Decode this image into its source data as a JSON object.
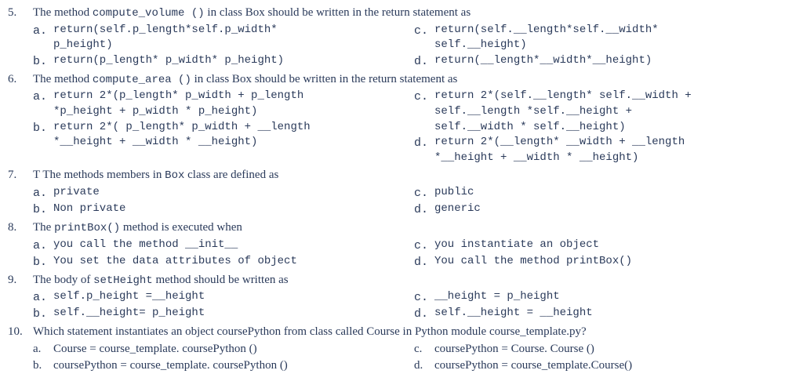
{
  "questions": [
    {
      "num": "5.",
      "stem_pre": "The method ",
      "stem_code": "compute_volume ()",
      "stem_post": "  in class Box should be written in the return statement as",
      "options": {
        "a": {
          "letter": "a.",
          "lines": [
            "return(self.p_length*self.p_width*",
            "p_height)"
          ]
        },
        "b": {
          "letter": "b.",
          "lines": [
            "return(p_length* p_width* p_height)"
          ]
        },
        "c": {
          "letter": "c.",
          "lines": [
            "return(self.__length*self.__width*",
            "self.__height)"
          ]
        },
        "d": {
          "letter": "d.",
          "lines": [
            "return(__length*__width*__height)"
          ]
        }
      }
    },
    {
      "num": "6.",
      "stem_pre": "The method ",
      "stem_code": "compute_area ()",
      "stem_post": "  in class Box should be written in the return statement as",
      "options": {
        "a": {
          "letter": "a.",
          "lines": [
            "return 2*(p_length* p_width + p_length",
            "*p_height + p_width * p_height)"
          ]
        },
        "b": {
          "letter": "b.",
          "lines": [
            "return 2*( p_length* p_width + __length",
            "*__height + __width * __height)"
          ]
        },
        "c": {
          "letter": "c.",
          "lines": [
            "return 2*(self.__length* self.__width +",
            "self.__length *self.__height +",
            "self.__width * self.__height)"
          ]
        },
        "d": {
          "letter": "d.",
          "lines": [
            "return 2*(__length* __width + __length",
            "*__height + __width * __height)"
          ]
        }
      }
    },
    {
      "num": "7.",
      "stem_pre": "T   The methods members in ",
      "stem_code": "Box",
      "stem_post": " class  are defined as",
      "options": {
        "a": {
          "letter": "a.",
          "lines": [
            "private"
          ]
        },
        "b": {
          "letter": "b.",
          "lines": [
            "Non private"
          ]
        },
        "c": {
          "letter": "c.",
          "lines": [
            "public"
          ]
        },
        "d": {
          "letter": "d.",
          "lines": [
            "generic"
          ]
        }
      }
    },
    {
      "num": "8.",
      "stem_pre": "The ",
      "stem_code": "printBox()",
      "stem_post": " method is executed when",
      "options": {
        "a": {
          "letter": "a.",
          "lines": [
            "you call the method __init__"
          ]
        },
        "b": {
          "letter": "b.",
          "lines": [
            "You set the data attributes of object"
          ]
        },
        "c": {
          "letter": "c.",
          "lines": [
            "you instantiate an object"
          ]
        },
        "d": {
          "letter": "d.",
          "lines": [
            "You call the method printBox()"
          ]
        }
      }
    },
    {
      "num": "9.",
      "stem_pre": "The body of ",
      "stem_code": "setHeight",
      "stem_post": "  method should be written as",
      "options": {
        "a": {
          "letter": "a.",
          "lines": [
            "self.p_height =__height"
          ]
        },
        "b": {
          "letter": "b.",
          "lines": [
            "self.__height= p_height"
          ]
        },
        "c": {
          "letter": "c.",
          "lines": [
            "__height = p_height"
          ]
        },
        "d": {
          "letter": "d.",
          "lines": [
            "self.__height = __height"
          ]
        }
      }
    },
    {
      "num": "10.",
      "stem_full": "Which statement instantiates an object coursePython from class called Course in Python module course_template.py?",
      "options": {
        "a": {
          "letter": "a.",
          "lines": [
            "Course = course_template. coursePython ()"
          ]
        },
        "b": {
          "letter": "b.",
          "lines": [
            "coursePython = course_template. coursePython ()"
          ]
        },
        "c": {
          "letter": "c.",
          "lines": [
            "coursePython = Course. Course ()"
          ]
        },
        "d": {
          "letter": "d.",
          "lines": [
            "coursePython = course_template.Course()"
          ]
        }
      }
    }
  ]
}
